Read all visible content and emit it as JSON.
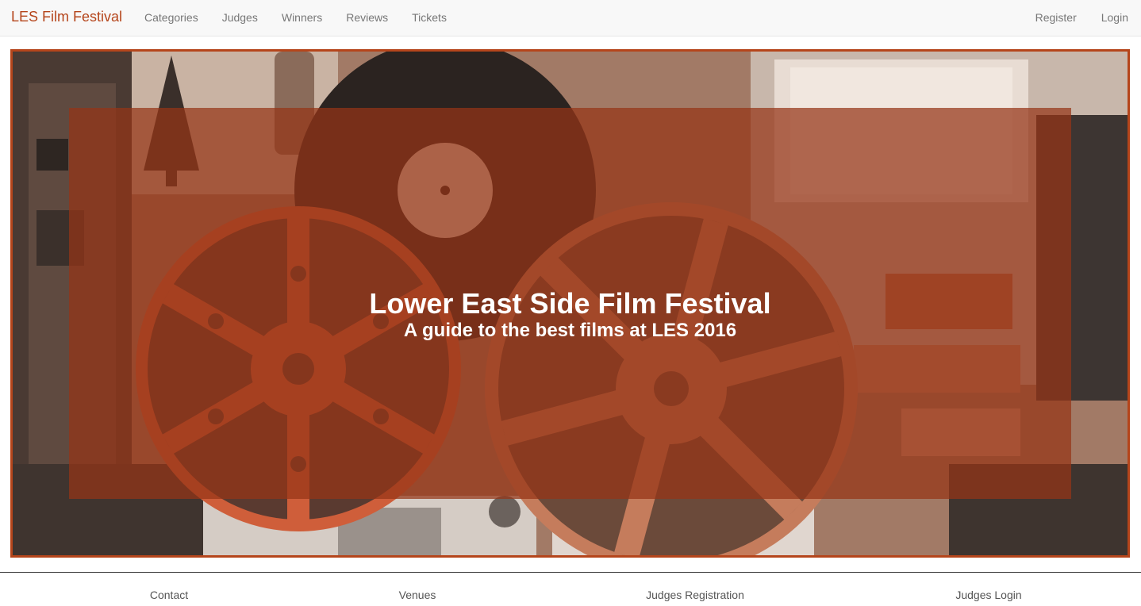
{
  "navbar": {
    "brand": "LES Film Festival",
    "left_items": [
      "Categories",
      "Judges",
      "Winners",
      "Reviews",
      "Tickets"
    ],
    "right_items": [
      "Register",
      "Login"
    ]
  },
  "hero": {
    "title": "Lower East Side Film Festival",
    "subtitle": "A guide to the best films at LES 2016"
  },
  "footer": {
    "links": [
      "Contact",
      "Venues",
      "Judges Registration",
      "Judges Login"
    ]
  },
  "colors": {
    "brand": "#b5451b",
    "hero_border": "#b5451b",
    "overlay": "#963416",
    "nav_text": "#777777"
  }
}
